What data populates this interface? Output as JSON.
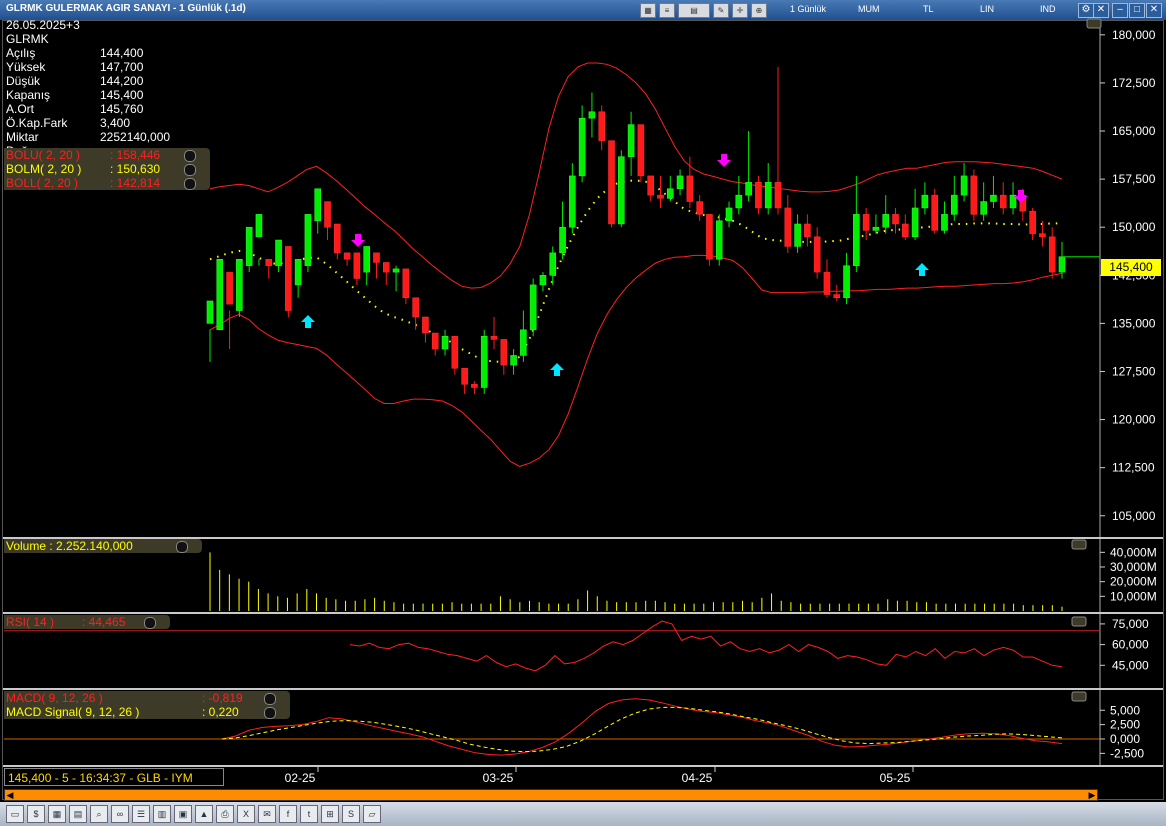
{
  "window": {
    "title": "GLRMK GULERMAK AGIR SANAYI - 1 Günlük (.1d)",
    "tabs": [
      "1 Günlük",
      "MUM",
      "TL",
      "LIN",
      "IND"
    ],
    "toolbar_icons": [
      "table-icon",
      "news-icon",
      "chart-icon",
      "draw-icon",
      "crosshair-icon",
      "zoom-icon"
    ]
  },
  "info": {
    "date": "26.05.2025+3",
    "symbol": "GLRMK",
    "rows": [
      {
        "label": "Açılış",
        "value": "144,400"
      },
      {
        "label": "Yüksek",
        "value": "147,700"
      },
      {
        "label": "Düşük",
        "value": "144,200"
      },
      {
        "label": "Kapanış",
        "value": "145,400"
      },
      {
        "label": "A.Ort",
        "value": "145,760"
      },
      {
        "label": "Ö.Kap.Fark",
        "value": "3,400"
      },
      {
        "label": "Miktar",
        "value": "2252140,000"
      },
      {
        "label": "Değer",
        "value": ""
      }
    ]
  },
  "bollinger": [
    {
      "label": "BOLU( 2, 20 )",
      "value": ": 158,446",
      "color": "#ff2020"
    },
    {
      "label": "BOLM( 2, 20 )",
      "value": ": 150,630",
      "color": "#ffff00"
    },
    {
      "label": "BOLL( 2, 20 )",
      "value": ": 142,814",
      "color": "#ff2020"
    }
  ],
  "volume_legend": "Volume : 2.252.140,000",
  "rsi_legend": {
    "label": "RSI( 14 )",
    "value": ": 44,465"
  },
  "macd_legend": [
    {
      "label": "MACD( 9, 12, 26 )",
      "value": ": -0,819",
      "color": "#ff2020"
    },
    {
      "label": "MACD Signal( 9, 12, 26 )",
      "value": ": 0,220",
      "color": "#ffff00"
    }
  ],
  "price_tag": "145,400",
  "status": "145,400 - 5 - 16:34:37 - GLB - IYM",
  "bottom_icons": [
    "folder-icon",
    "money-icon",
    "calculator-icon",
    "grid-icon",
    "search-icon",
    "link-icon",
    "ranking-icon",
    "database-icon",
    "news-icon",
    "chart-icon",
    "print-icon",
    "excel-icon",
    "mail-icon",
    "facebook-icon",
    "twitter-icon",
    "windows-icon",
    "skype-icon",
    "folder-open-icon"
  ],
  "chart_data": {
    "type": "candlestick",
    "price_axis": {
      "ticks": [
        "180,000",
        "172,500",
        "165,000",
        "157,500",
        "150,000",
        "142,500",
        "135,000",
        "127,500",
        "120,000",
        "112,500",
        "105,000"
      ],
      "range": [
        102,
        182
      ]
    },
    "x_labels": [
      "02-25",
      "03-25",
      "04-25",
      "05-25"
    ],
    "candles": [
      [
        135,
        138.5,
        129,
        134
      ],
      [
        134,
        145,
        134,
        143
      ],
      [
        143,
        138,
        131,
        137
      ],
      [
        137,
        145,
        136,
        144
      ],
      [
        144,
        150,
        143,
        148.5
      ],
      [
        148.5,
        152,
        144,
        145
      ],
      [
        145,
        144,
        142,
        144
      ],
      [
        144,
        148,
        143,
        147
      ],
      [
        147,
        137,
        136,
        141
      ],
      [
        141,
        145,
        139,
        144
      ],
      [
        144,
        152,
        143,
        151
      ],
      [
        151,
        156,
        149,
        154
      ],
      [
        154,
        150,
        148,
        150.5
      ],
      [
        150.5,
        146,
        145,
        146
      ],
      [
        146,
        145,
        144,
        146
      ],
      [
        146,
        142,
        141,
        143
      ],
      [
        143,
        147,
        141,
        146
      ],
      [
        146,
        144.5,
        142,
        145
      ],
      [
        144.5,
        143,
        141,
        143.5
      ],
      [
        143,
        143.5,
        140,
        144
      ],
      [
        143.5,
        139,
        138,
        140
      ],
      [
        139,
        136,
        134,
        138
      ],
      [
        136,
        133.5,
        132,
        134
      ],
      [
        133.5,
        131,
        130,
        133
      ],
      [
        131,
        133,
        130,
        134
      ],
      [
        133,
        128,
        127,
        129
      ],
      [
        128,
        125.5,
        124,
        126
      ],
      [
        125.5,
        125,
        124,
        126
      ],
      [
        125,
        133,
        124,
        134
      ],
      [
        133,
        132.5,
        131,
        136
      ],
      [
        132.5,
        128.5,
        127,
        129.5
      ],
      [
        128.5,
        130,
        127,
        131
      ],
      [
        130,
        134,
        129,
        137
      ],
      [
        134,
        141,
        133,
        142
      ],
      [
        141,
        142.5,
        140,
        143
      ],
      [
        142.5,
        146,
        141,
        147
      ],
      [
        146,
        150,
        145,
        154
      ],
      [
        150,
        158,
        149,
        160
      ],
      [
        158,
        167,
        157,
        169
      ],
      [
        167,
        168,
        164,
        171
      ],
      [
        168,
        163.5,
        162,
        169
      ],
      [
        163.5,
        150.5,
        150,
        152
      ],
      [
        150.5,
        161,
        150,
        162
      ],
      [
        161,
        166,
        158,
        168
      ],
      [
        166,
        158,
        157,
        160
      ],
      [
        158,
        155,
        154,
        156
      ],
      [
        155,
        154.5,
        153,
        158
      ],
      [
        154.5,
        156,
        154,
        158
      ],
      [
        156,
        158,
        155,
        159
      ],
      [
        158,
        154,
        153,
        161
      ],
      [
        154,
        152,
        151,
        155
      ],
      [
        152,
        145,
        144,
        147
      ],
      [
        145,
        151,
        144,
        152
      ],
      [
        151,
        153,
        150,
        154
      ],
      [
        153,
        155,
        152,
        158
      ],
      [
        155,
        157,
        154,
        165
      ],
      [
        157,
        153,
        152,
        158
      ],
      [
        153,
        157,
        152,
        160
      ],
      [
        157,
        153,
        152,
        175
      ],
      [
        153,
        147,
        146,
        155
      ],
      [
        147,
        150.5,
        146,
        152
      ],
      [
        150.5,
        148.5,
        147,
        152
      ],
      [
        148.5,
        143,
        142,
        150
      ],
      [
        143,
        139.5,
        139,
        145
      ],
      [
        139.5,
        139,
        138.5,
        141
      ],
      [
        139,
        144,
        138,
        146
      ],
      [
        144,
        152,
        143,
        158
      ],
      [
        152,
        149.5,
        148,
        153
      ],
      [
        149.5,
        150,
        149,
        152
      ],
      [
        150,
        152,
        149,
        155
      ],
      [
        152,
        150.5,
        149,
        153
      ],
      [
        150.5,
        148.5,
        148,
        152
      ],
      [
        148.5,
        153,
        148,
        156
      ],
      [
        153,
        155,
        152,
        157
      ],
      [
        155,
        149.5,
        149,
        156
      ],
      [
        149.5,
        152,
        149,
        154
      ],
      [
        152,
        155,
        151,
        158
      ],
      [
        155,
        158,
        154,
        160
      ],
      [
        158,
        152,
        151,
        159
      ],
      [
        152,
        154,
        151,
        157
      ],
      [
        154,
        155,
        153,
        158
      ],
      [
        155,
        153,
        152,
        157
      ],
      [
        153,
        155,
        152,
        157
      ],
      [
        155,
        152.5,
        151,
        156
      ],
      [
        152.5,
        149,
        148,
        153
      ],
      [
        149,
        148.5,
        147,
        151
      ],
      [
        148.5,
        143,
        142,
        150
      ],
      [
        143,
        145.4,
        142,
        147.7
      ]
    ],
    "upper_band": [
      156,
      156.3,
      156.5,
      156.7,
      156.5,
      156,
      155.5,
      156.2,
      157,
      158,
      159,
      159.5,
      158.5,
      157.3,
      156,
      154.6,
      153.2,
      152,
      150.7,
      149.5,
      148.1,
      146.6,
      145.3,
      144,
      142.8,
      141.7,
      140.8,
      140.5,
      140.6,
      141.3,
      142.4,
      144.3,
      147,
      152,
      158.5,
      165.4,
      170.4,
      173.5,
      175,
      175.6,
      175.6,
      175.4,
      174.8,
      173.8,
      172.5,
      170.8,
      168.4,
      165.5,
      162.6,
      160.3,
      159,
      158.3,
      157.9,
      157.5,
      157.1,
      156.9,
      156.6,
      156.4,
      156.2,
      156,
      155.8,
      155.6,
      155.5,
      155.5,
      155.6,
      155.8,
      156.3,
      156.8,
      157.5,
      158.2,
      158.6,
      158.9,
      159.2,
      159.2,
      159.5,
      159.8,
      160.1,
      160.2,
      160.2,
      160.2,
      160.1,
      160,
      159.8,
      159.6,
      159.4,
      159.2,
      158.7,
      158.1,
      157.5
    ],
    "lower_band": [
      134,
      134.8,
      135.8,
      136.4,
      135.6,
      134.2,
      133.2,
      132.4,
      132,
      131.7,
      131.4,
      131.1,
      130.1,
      128.7,
      127.4,
      126.1,
      124.7,
      123.3,
      122.5,
      122.5,
      122.9,
      123.2,
      123.2,
      123.1,
      122.9,
      122.2,
      121.2,
      119.8,
      118.3,
      116.9,
      115.2,
      113.5,
      112.7,
      113.2,
      114,
      115.3,
      117.5,
      120.9,
      125.1,
      129.5,
      133.4,
      136.4,
      138.7,
      140.6,
      142.1,
      143.3,
      144.4,
      145,
      145.3,
      145.4,
      145.6,
      145.6,
      145.5,
      145.2,
      144.8,
      143.7,
      142,
      140.2,
      139.8,
      139.8,
      139.8,
      139.8,
      139.9,
      139.9,
      140,
      140,
      140.1,
      140.1,
      140.2,
      140.3,
      140.3,
      140.4,
      140.5,
      140.5,
      140.6,
      140.7,
      140.8,
      140.8,
      140.9,
      141,
      141.1,
      141.2,
      141.2,
      141.3,
      141.5,
      141.8,
      142.2,
      142.5,
      142.8
    ],
    "middle_band": [
      145,
      145.5,
      146,
      146.3,
      146,
      145.3,
      144.4,
      144.3,
      144.5,
      144.8,
      145.2,
      145.3,
      144.3,
      143,
      141.7,
      140.3,
      139,
      137.7,
      136.6,
      136,
      135.5,
      134.9,
      134.3,
      133.5,
      132.8,
      132,
      131,
      130.2,
      129.4,
      129.1,
      129,
      129,
      129.8,
      132.6,
      136.3,
      140.3,
      144,
      147.2,
      150,
      152.5,
      154.5,
      155.9,
      156.8,
      157.2,
      157.3,
      157.1,
      156.4,
      155.2,
      154,
      152.8,
      152.3,
      151.9,
      151.7,
      151.4,
      151,
      150.3,
      149.3,
      148.3,
      148,
      147.9,
      147.8,
      147.7,
      147.7,
      147.7,
      147.8,
      147.9,
      148.2,
      148.5,
      148.8,
      149.2,
      149.5,
      149.6,
      149.8,
      149.9,
      150,
      150.2,
      150.4,
      150.5,
      150.5,
      150.6,
      150.6,
      150.6,
      150.5,
      150.5,
      150.4,
      150.5,
      150.5,
      150.6,
      150.6
    ],
    "volume_axis": {
      "ticks": [
        "40,000M",
        "30,000M",
        "20,000M",
        "10,000M"
      ],
      "max": 45
    },
    "volume_m": [
      40,
      28,
      25,
      22,
      20,
      15,
      12,
      10,
      9,
      12,
      15,
      12,
      9,
      8,
      7,
      7,
      8,
      9,
      7,
      6,
      5,
      5,
      5,
      5,
      5,
      6,
      5,
      5,
      5,
      5,
      10,
      8,
      6,
      7,
      6,
      5,
      5,
      5,
      8,
      14,
      10,
      7,
      6,
      6,
      6,
      7,
      7,
      6,
      5,
      5,
      5,
      5,
      6,
      6,
      6,
      7,
      6,
      9,
      12,
      7,
      6,
      5,
      5,
      5,
      5,
      5,
      5,
      5,
      5,
      5,
      8,
      7,
      7,
      6,
      6,
      5,
      5,
      5,
      5,
      5,
      5,
      5,
      5,
      5,
      4,
      4,
      4,
      4,
      3
    ],
    "rsi_axis": {
      "ticks": [
        "75,000",
        "60,000",
        "45,000"
      ],
      "range": [
        30,
        80
      ],
      "line_value": 70
    },
    "rsi": [
      60,
      59,
      61,
      58,
      57,
      60,
      61,
      58,
      57,
      55,
      53,
      52,
      50,
      48,
      52,
      47,
      44,
      46,
      43,
      41,
      45,
      52,
      46,
      47,
      50,
      54,
      59,
      62,
      60,
      63,
      68,
      73,
      77,
      75,
      63,
      66,
      64,
      66,
      59,
      62,
      57,
      55,
      57,
      54,
      56,
      60,
      55,
      60,
      58,
      55,
      50,
      52,
      51,
      49,
      46,
      45,
      53,
      51,
      55,
      52,
      57,
      50,
      55,
      54,
      57,
      52,
      56,
      58,
      56,
      51,
      51,
      48,
      45,
      44
    ],
    "macd_axis": {
      "ticks": [
        "5,000",
        "2,500",
        "0,000",
        "-2,500"
      ],
      "range": [
        -4,
        8
      ]
    },
    "macd": [
      0,
      0.5,
      1.5,
      2,
      2.2,
      2.3,
      2.5,
      3,
      3.7,
      3.5,
      3,
      2.4,
      1.9,
      1.4,
      0.9,
      0.4,
      -0.4,
      -1.2,
      -1.8,
      -2.4,
      -2.7,
      -2.8,
      -2.6,
      -2.2,
      -1.5,
      -0.5,
      1,
      2.8,
      4.8,
      6.2,
      6.8,
      7,
      6.8,
      6.3,
      5.7,
      5.2,
      4.8,
      4.6,
      4.2,
      3.8,
      3.2,
      2.8,
      2.2,
      1.4,
      0.6,
      -0.4,
      -1.1,
      -1.4,
      -1.3,
      -1.1,
      -0.9,
      -0.6,
      -0.3,
      0,
      0.3,
      0.7,
      0.9,
      1,
      0.9,
      0.6,
      0.1,
      -0.3,
      -0.5,
      -0.8
    ],
    "macd_signal": [
      0,
      0.2,
      0.6,
      1.1,
      1.6,
      2,
      2.4,
      2.8,
      3.1,
      3.2,
      3.1,
      2.9,
      2.5,
      2.1,
      1.6,
      1,
      0.4,
      -0.2,
      -0.9,
      -1.4,
      -1.8,
      -2.1,
      -2.2,
      -2.1,
      -1.8,
      -1.3,
      -0.4,
      0.8,
      2.2,
      3.5,
      4.5,
      5.2,
      5.5,
      5.5,
      5.3,
      5,
      4.7,
      4.3,
      3.8,
      3.4,
      2.8,
      2.3,
      1.7,
      1,
      0.3,
      -0.3,
      -0.7,
      -0.8,
      -0.7,
      -0.6,
      -0.4,
      -0.2,
      0,
      0.3,
      0.5,
      0.6,
      0.8,
      0.9,
      0.8,
      0.6,
      0.4,
      0.2
    ]
  }
}
